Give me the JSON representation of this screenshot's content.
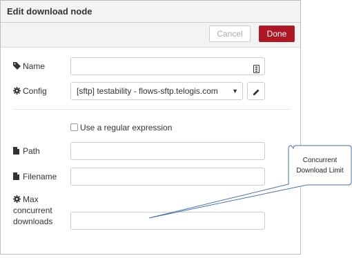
{
  "dialog": {
    "title": "Edit download node",
    "cancel_label": "Cancel",
    "done_label": "Done"
  },
  "form": {
    "name_label": "Name",
    "name_value": "",
    "config_label": "Config",
    "config_value": "[sftp] testability - flows-sftp.telogis.com",
    "regex_label": "Use a regular expression",
    "regex_checked": false,
    "path_label": "Path",
    "path_value": "",
    "filename_label": "Filename",
    "filename_value": "",
    "max_label_1": "Max",
    "max_label_2": "concurrent",
    "max_label_3": "downloads",
    "max_value": ""
  },
  "annotation": {
    "line1": "Concurrent",
    "line2": "Download Limit"
  },
  "icons": {
    "name": "tag-icon",
    "config": "cog-icon",
    "path": "file-icon",
    "filename": "file-icon",
    "max": "cog-icon",
    "edit": "pencil-icon",
    "name_field": "translate-icon"
  },
  "colors": {
    "done_button": "#ad1625",
    "callout_border": "#4a6fa5"
  }
}
